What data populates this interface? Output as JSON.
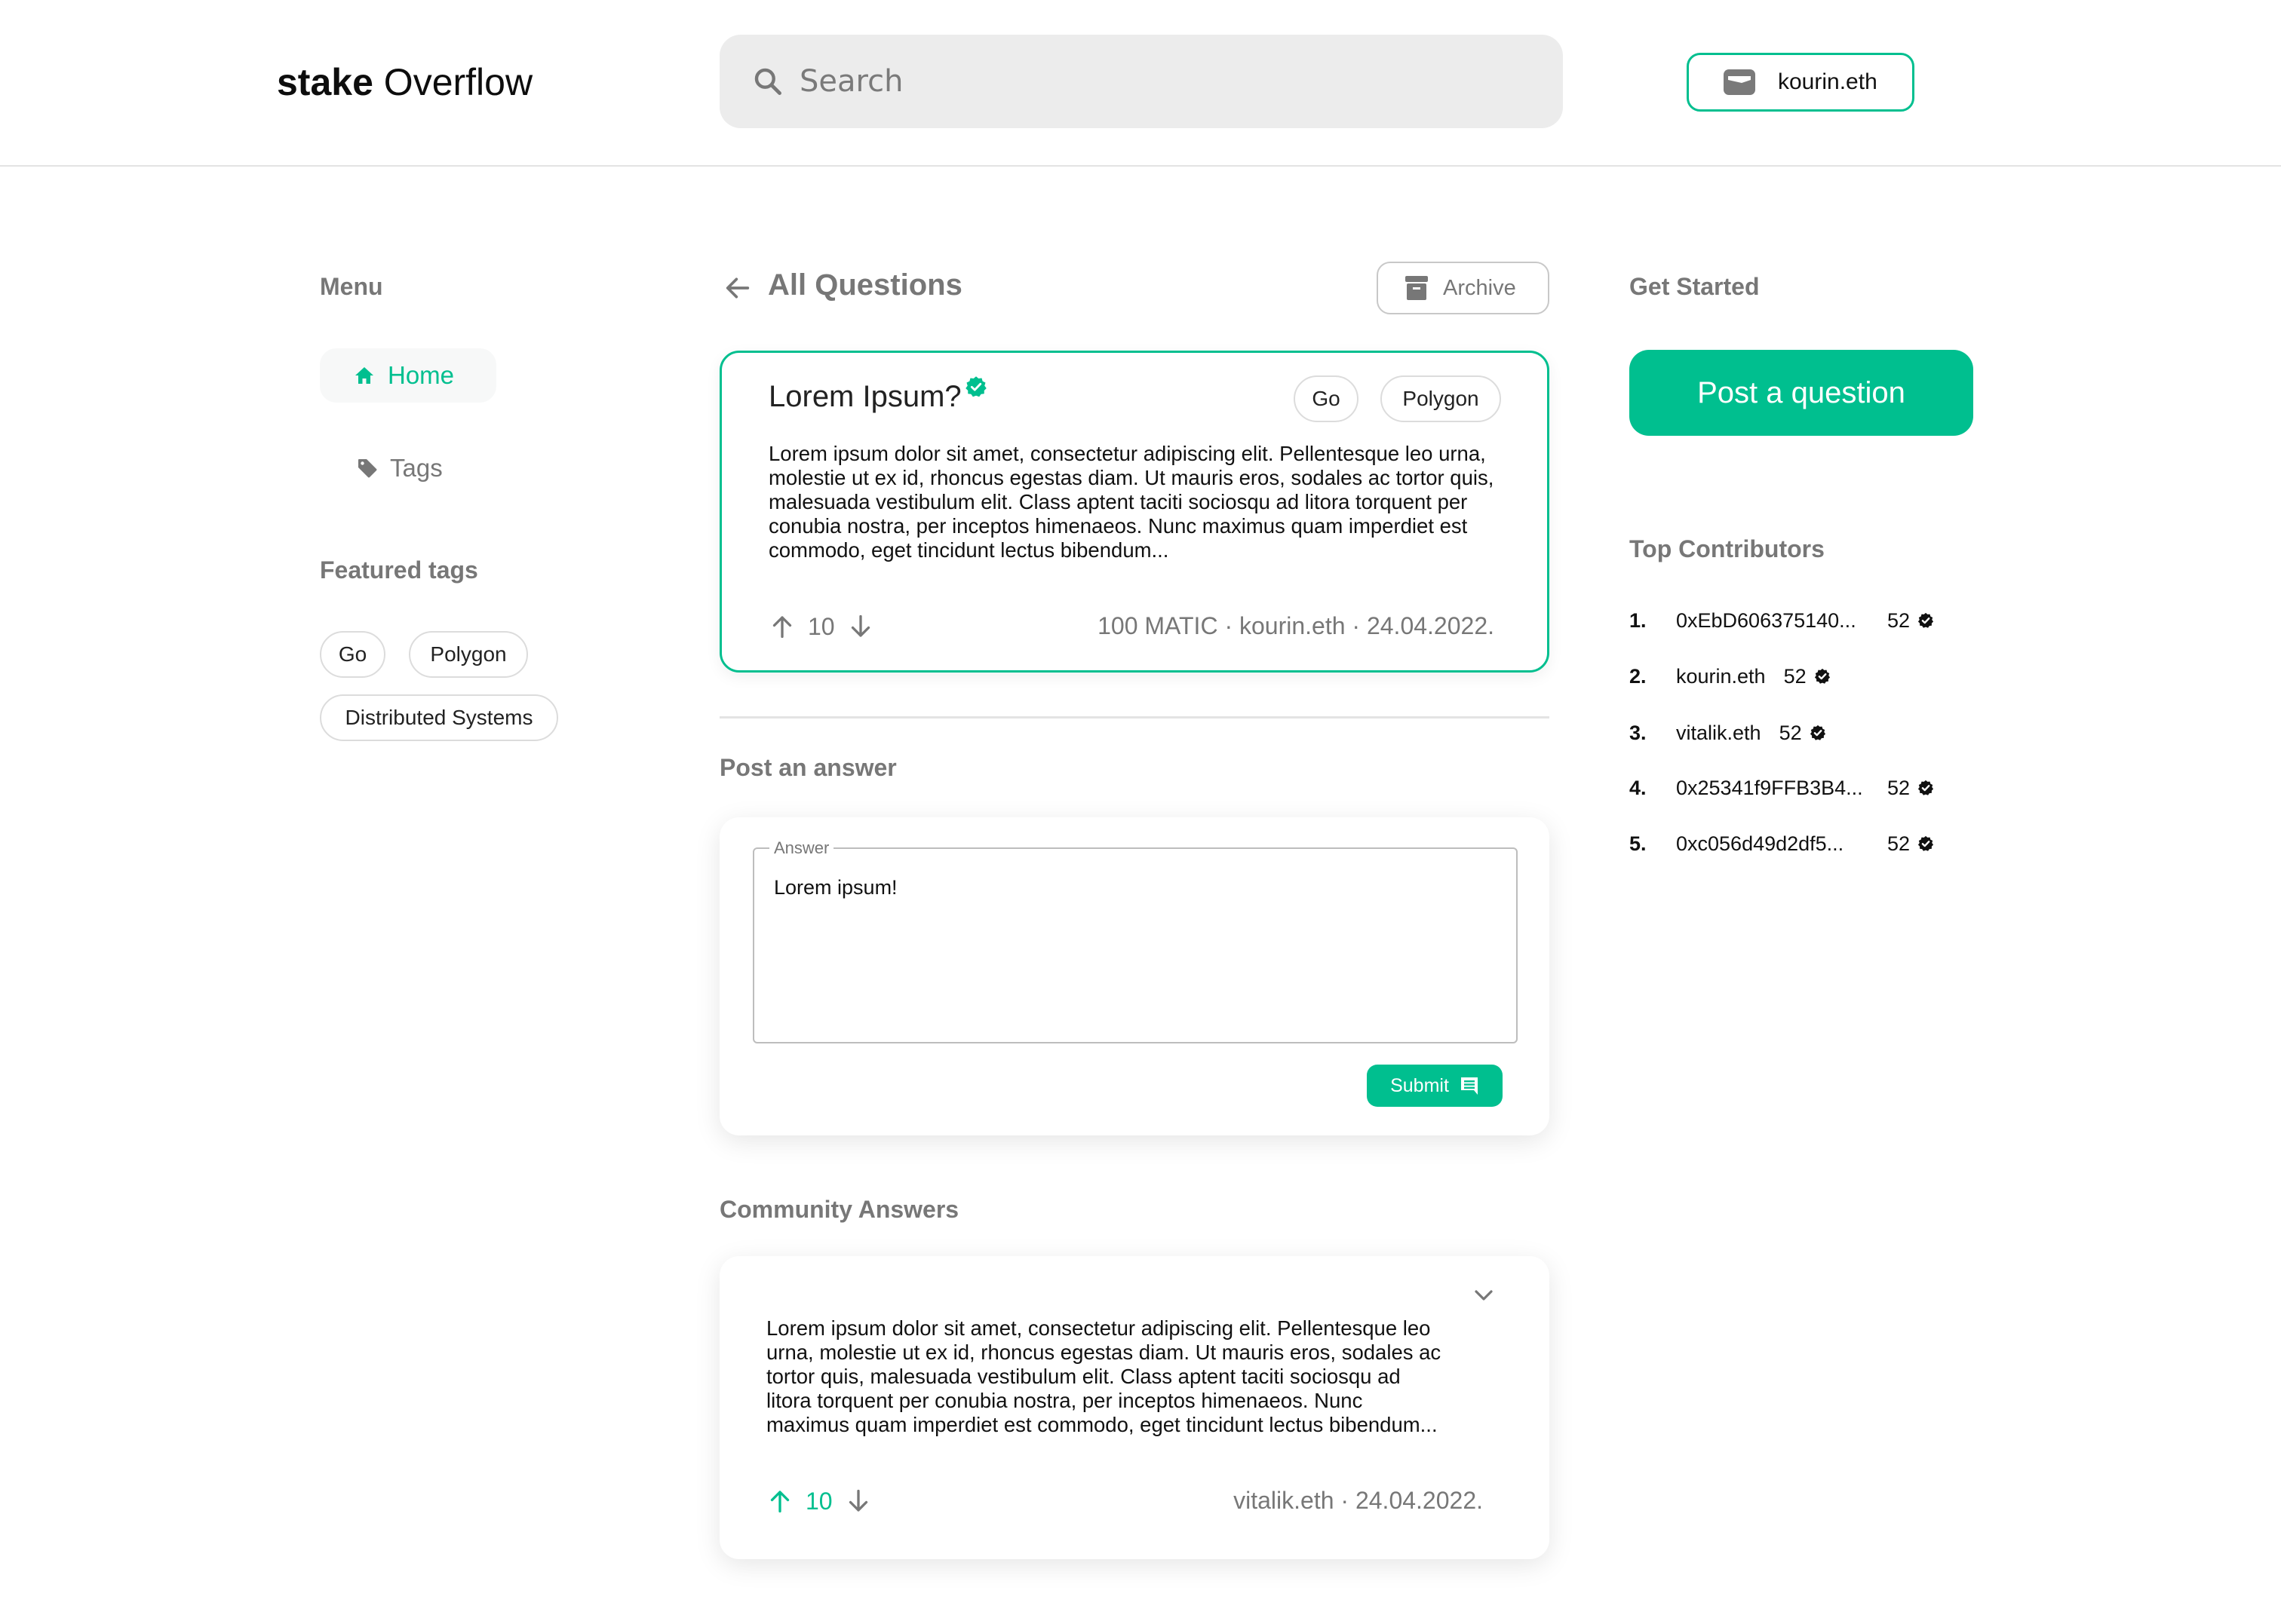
{
  "header": {
    "logo_bold": "stake",
    "logo_light": "Overflow",
    "search_placeholder": "Search",
    "wallet_label": "kourin.eth"
  },
  "sidebar": {
    "menu_title": "Menu",
    "items": [
      {
        "label": "Home",
        "icon": "home-icon",
        "active": true
      },
      {
        "label": "Tags",
        "icon": "tag-icon",
        "active": false
      }
    ],
    "featured_title": "Featured tags",
    "featured_tags": [
      "Go",
      "Polygon",
      "Distributed Systems"
    ]
  },
  "main": {
    "back_title": "All Questions",
    "archive_label": "Archive",
    "question": {
      "title": "Lorem Ipsum?",
      "verified": true,
      "tags": [
        "Go",
        "Polygon"
      ],
      "body": "Lorem ipsum dolor sit amet, consectetur adipiscing elit. Pellentesque leo urna, molestie ut ex id, rhoncus egestas diam. Ut mauris eros, sodales ac tortor quis, malesuada vestibulum elit. Class aptent taciti sociosqu ad litora torquent per conubia nostra, per inceptos himenaeos. Nunc maximus quam imperdiet est commodo, eget tincidunt lectus bibendum...",
      "votes": "10",
      "meta": "100 MATIC · kourin.eth · 24.04.2022."
    },
    "post_answer": {
      "title": "Post an answer",
      "field_label": "Answer",
      "field_value": "Lorem ipsum!",
      "submit_label": "Submit"
    },
    "community": {
      "title": "Community Answers",
      "answers": [
        {
          "body": "Lorem ipsum dolor sit amet, consectetur adipiscing elit. Pellentesque leo urna, molestie ut ex id, rhoncus egestas diam. Ut mauris eros, sodales ac tortor quis, malesuada vestibulum elit. Class aptent taciti sociosqu ad litora torquent per conubia nostra, per inceptos himenaeos. Nunc maximus quam imperdiet est commodo, eget tincidunt lectus bibendum...",
          "votes": "10",
          "upvoted": true,
          "meta": "vitalik.eth · 24.04.2022."
        }
      ]
    }
  },
  "right": {
    "get_started_title": "Get Started",
    "post_question_label": "Post a question",
    "top_contributors_title": "Top Contributors",
    "contributors": [
      {
        "rank": "1.",
        "name": "0xEbD606375140...",
        "score": "52"
      },
      {
        "rank": "2.",
        "name": "kourin.eth",
        "score": "52"
      },
      {
        "rank": "3.",
        "name": "vitalik.eth",
        "score": "52"
      },
      {
        "rank": "4.",
        "name": "0x25341f9FFB3B4...",
        "score": "52"
      },
      {
        "rank": "5.",
        "name": "0xc056d49d2df5...",
        "score": "52"
      }
    ]
  },
  "colors": {
    "accent": "#00bf8f",
    "muted": "#777777",
    "search_bg": "#ececec",
    "divider": "#e3e3e3"
  }
}
